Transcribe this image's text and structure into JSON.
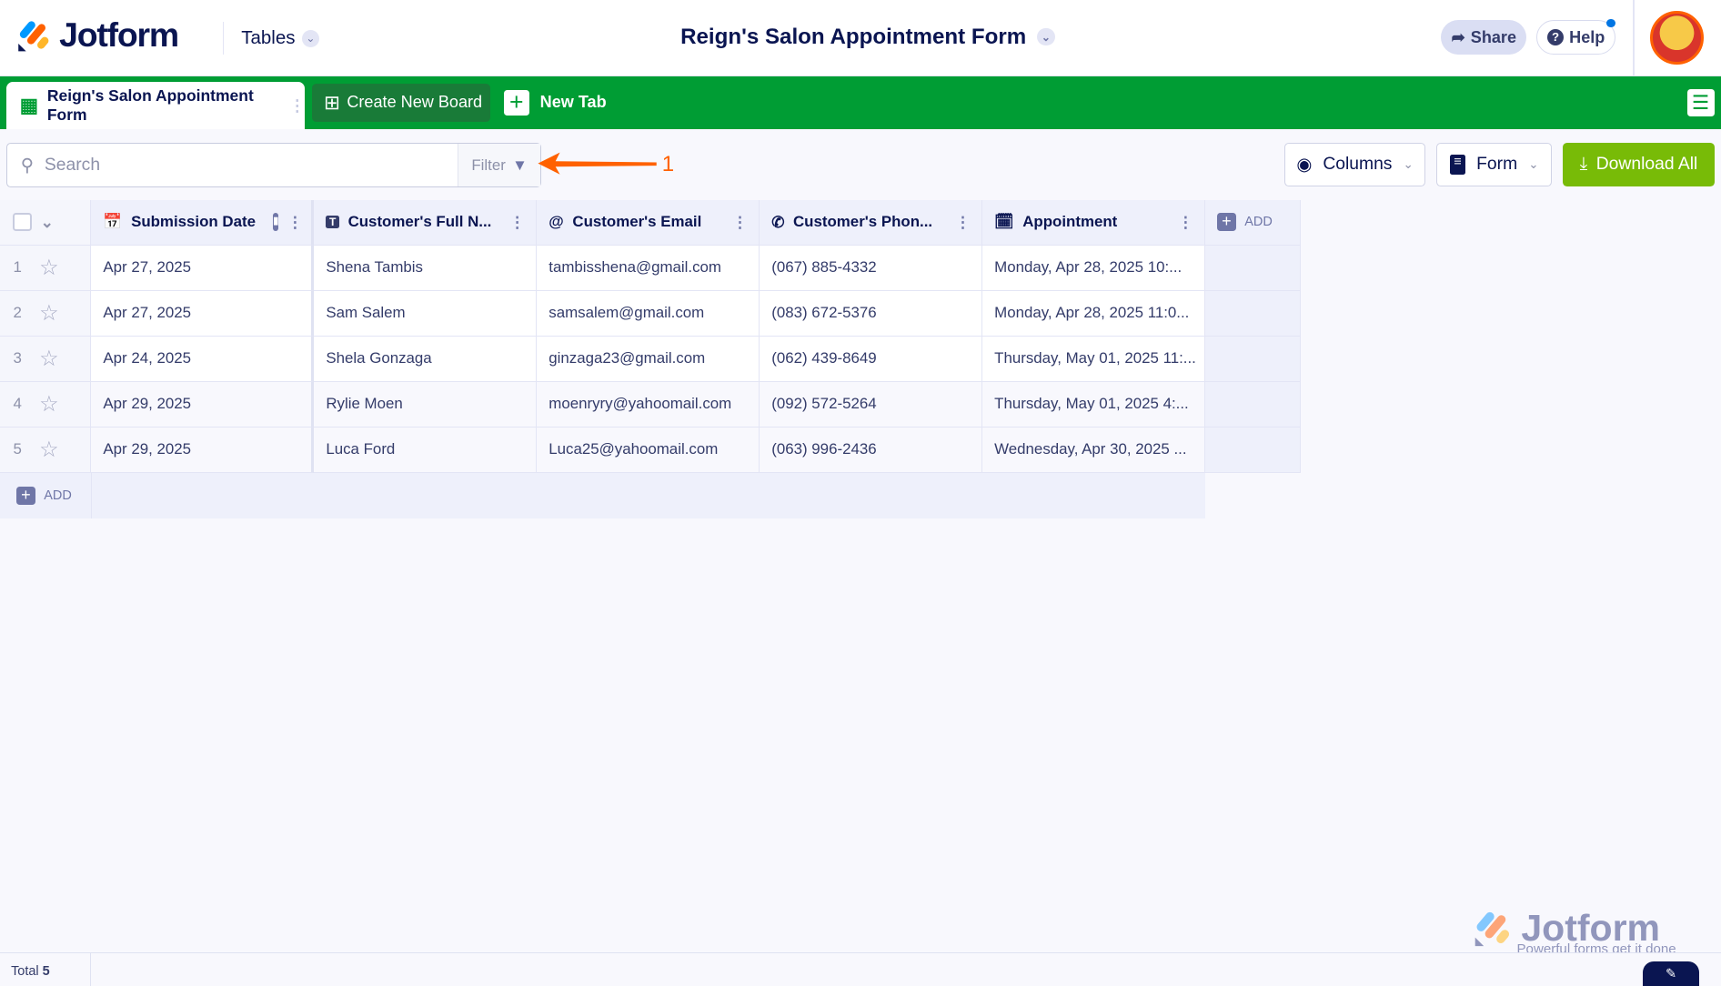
{
  "header": {
    "brand": "Jotform",
    "section": "Tables",
    "title": "Reign's Salon Appointment Form",
    "share": "Share",
    "help": "Help"
  },
  "tabs": {
    "active": "Reign's Salon Appointment Form",
    "create_board": "Create New Board",
    "new_tab": "New Tab"
  },
  "toolbar": {
    "search_placeholder": "Search",
    "filter": "Filter",
    "annotation": "1",
    "columns": "Columns",
    "form": "Form",
    "download": "Download All"
  },
  "table": {
    "columns": [
      "Submission Date",
      "Customer's Full N...",
      "Customer's Email",
      "Customer's Phon...",
      "Appointment"
    ],
    "add_column": "ADD",
    "add_row": "ADD",
    "rows": [
      {
        "n": "1",
        "date": "Apr 27, 2025",
        "name": "Shena Tambis",
        "email": "tambisshena@gmail.com",
        "phone": "(067) 885-4332",
        "appt": "Monday, Apr 28, 2025 10:..."
      },
      {
        "n": "2",
        "date": "Apr 27, 2025",
        "name": "Sam Salem",
        "email": "samsalem@gmail.com",
        "phone": "(083) 672-5376",
        "appt": "Monday, Apr 28, 2025 11:0..."
      },
      {
        "n": "3",
        "date": "Apr 24, 2025",
        "name": "Shela Gonzaga",
        "email": "ginzaga23@gmail.com",
        "phone": "(062) 439-8649",
        "appt": "Thursday, May 01, 2025 11:..."
      },
      {
        "n": "4",
        "date": "Apr 29, 2025",
        "name": "Rylie Moen",
        "email": "moenryry@yahoomail.com",
        "phone": "(092) 572-5264",
        "appt": "Thursday, May 01, 2025 4:..."
      },
      {
        "n": "5",
        "date": "Apr 29, 2025",
        "name": "Luca Ford",
        "email": "Luca25@yahoomail.com",
        "phone": "(063) 996-2436",
        "appt": "Wednesday, Apr 30, 2025 ..."
      }
    ]
  },
  "footer": {
    "total_label": "Total",
    "total": "5"
  },
  "watermark": {
    "brand": "Jotform",
    "tagline": "Powerful forms get it done"
  },
  "colors": {
    "green": "#009d34",
    "download": "#78bb07",
    "navy": "#0a1551",
    "orange": "#ff6100"
  }
}
